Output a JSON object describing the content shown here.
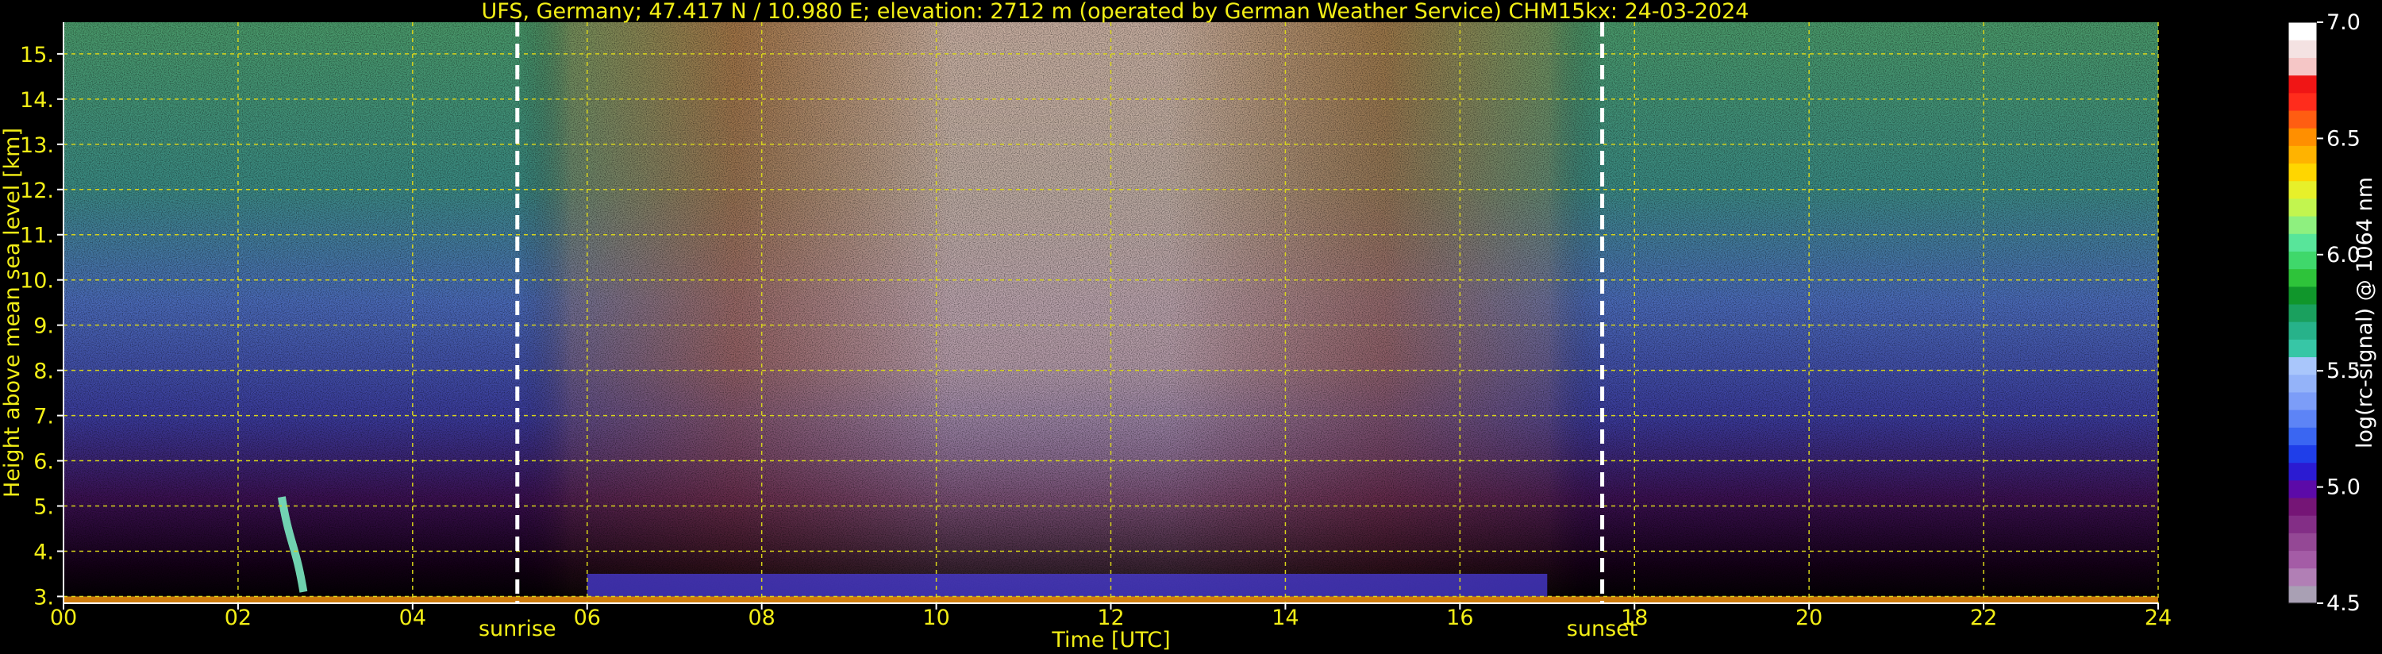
{
  "chart_data": {
    "type": "heatmap",
    "title": "UFS, Germany; 47.417 N / 10.980 E; elevation: 2712 m  (operated by German Weather Service)    CHM15kx: 24-03-2024",
    "xlabel": "Time [UTC]",
    "ylabel": "Height above mean sea level [km]",
    "xlim": [
      0,
      24
    ],
    "ylim": [
      2.85,
      15.7
    ],
    "xticks": [
      0,
      2,
      4,
      6,
      8,
      10,
      12,
      14,
      16,
      18,
      20,
      22,
      24
    ],
    "xtick_labels": [
      "00",
      "02",
      "04",
      "06",
      "08",
      "10",
      "12",
      "14",
      "16",
      "18",
      "20",
      "22",
      "24"
    ],
    "yticks": [
      3,
      4,
      5,
      6,
      7,
      8,
      9,
      10,
      11,
      12,
      13,
      14,
      15
    ],
    "ytick_labels": [
      "3.",
      "4.",
      "5.",
      "6.",
      "7.",
      "8.",
      "9.",
      "10.",
      "11.",
      "12.",
      "13.",
      "14.",
      "15."
    ],
    "grid": true,
    "events": [
      {
        "label": "sunrise",
        "time": 5.2
      },
      {
        "label": "sunset",
        "time": 17.63
      }
    ],
    "colorbar": {
      "label": "log(rc-signal) @ 1064 nm",
      "range": [
        4.5,
        7.0
      ],
      "ticks": [
        4.5,
        5.0,
        5.5,
        6.0,
        6.5,
        7.0
      ],
      "tick_labels": [
        "4.5",
        "5.0",
        "5.5",
        "6.0",
        "6.5",
        "7.0"
      ],
      "colors": [
        "#a9a0b4",
        "#b17fb5",
        "#a45ca6",
        "#944895",
        "#832e86",
        "#751576",
        "#5c0aa8",
        "#2b1bd2",
        "#1f3ee9",
        "#3a66f2",
        "#5d84f6",
        "#7c9df8",
        "#94b3f9",
        "#a9c6fb",
        "#37c6a6",
        "#27b28a",
        "#1aa05e",
        "#10962b",
        "#2ec33a",
        "#3fd86b",
        "#58e59a",
        "#8ef07f",
        "#c2f54f",
        "#e7f02a",
        "#ffd600",
        "#ffb300",
        "#ff8f00",
        "#ff5d12",
        "#ff2c1c",
        "#f01515",
        "#f5c6c6",
        "#f4e2e2",
        "#ffffff"
      ]
    },
    "background_signal_profile": [
      {
        "time": 0,
        "level": 5.4
      },
      {
        "time": 5.2,
        "level": 5.5
      },
      {
        "time": 6.5,
        "level": 6.2
      },
      {
        "time": 9,
        "level": 6.7
      },
      {
        "time": 12,
        "level": 6.85
      },
      {
        "time": 15,
        "level": 6.6
      },
      {
        "time": 17,
        "level": 6.0
      },
      {
        "time": 18,
        "level": 5.6
      },
      {
        "time": 24,
        "level": 5.4
      }
    ],
    "features": [
      {
        "name": "surface layer",
        "time_start": 0,
        "time_end": 24,
        "height_top_km": 3.0
      },
      {
        "name": "elevated plume",
        "time_start": 2.5,
        "time_end": 2.75,
        "height_bottom_km": 3.1,
        "height_top_km": 5.2
      },
      {
        "name": "daytime boundary layer",
        "time_start": 6,
        "time_end": 17,
        "height_top_km": 3.5
      }
    ]
  }
}
